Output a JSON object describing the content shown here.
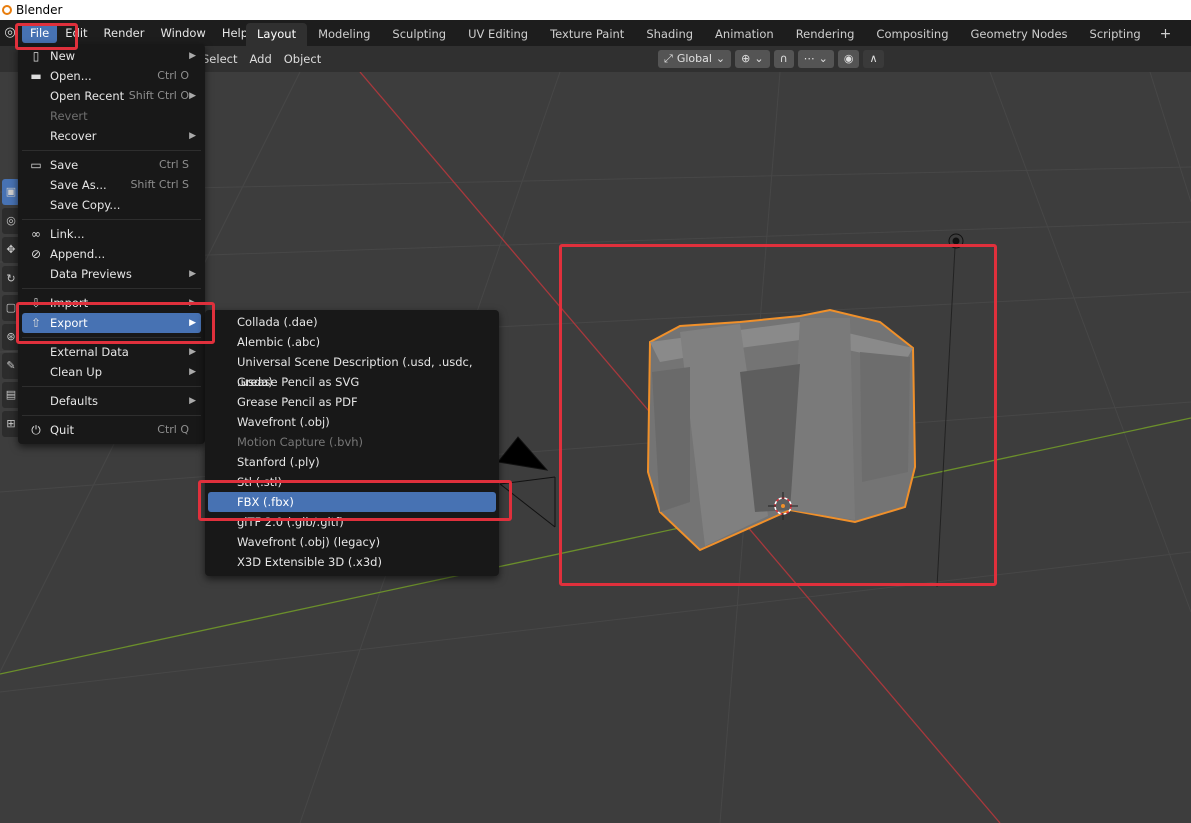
{
  "window": {
    "title": "Blender"
  },
  "topbar": {
    "menus": [
      "File",
      "Edit",
      "Render",
      "Window",
      "Help"
    ],
    "active_menu": "File",
    "workspaces": [
      "Layout",
      "Modeling",
      "Sculpting",
      "UV Editing",
      "Texture Paint",
      "Shading",
      "Animation",
      "Rendering",
      "Compositing",
      "Geometry Nodes",
      "Scripting"
    ],
    "active_workspace": "Layout",
    "add_workspace": "+"
  },
  "viewport_header": {
    "menus": [
      "Select",
      "Add",
      "Object"
    ],
    "orientation": "Global"
  },
  "file_menu": {
    "items": [
      {
        "label": "New",
        "icon": "new-file-icon",
        "shortcut": "",
        "submenu": true
      },
      {
        "label": "Open...",
        "icon": "folder-icon",
        "shortcut": "Ctrl O"
      },
      {
        "label": "Open Recent",
        "shortcut": "Shift Ctrl O",
        "submenu": true
      },
      {
        "label": "Revert",
        "shortcut": "",
        "disabled": true
      },
      {
        "label": "Recover",
        "shortcut": "",
        "submenu": true
      },
      {
        "label": "Save",
        "icon": "save-icon",
        "shortcut": "Ctrl S"
      },
      {
        "label": "Save As...",
        "shortcut": "Shift Ctrl S"
      },
      {
        "label": "Save Copy...",
        "shortcut": ""
      },
      {
        "label": "Link...",
        "icon": "link-icon",
        "shortcut": ""
      },
      {
        "label": "Append...",
        "icon": "append-icon",
        "shortcut": ""
      },
      {
        "label": "Data Previews",
        "shortcut": "",
        "submenu": true
      },
      {
        "label": "Import",
        "icon": "import-icon",
        "shortcut": "",
        "submenu": true
      },
      {
        "label": "Export",
        "icon": "export-icon",
        "shortcut": "",
        "submenu": true,
        "highlighted": true
      },
      {
        "label": "External Data",
        "shortcut": "",
        "submenu": true
      },
      {
        "label": "Clean Up",
        "shortcut": "",
        "submenu": true
      },
      {
        "label": "Defaults",
        "shortcut": "",
        "submenu": true
      },
      {
        "label": "Quit",
        "icon": "quit-icon",
        "shortcut": "Ctrl Q"
      }
    ]
  },
  "export_menu": {
    "items": [
      {
        "label": "Collada (.dae)"
      },
      {
        "label": "Alembic (.abc)"
      },
      {
        "label": "Universal Scene Description (.usd, .usdc, .usda)"
      },
      {
        "label": "Grease Pencil as SVG"
      },
      {
        "label": "Grease Pencil as PDF"
      },
      {
        "label": "Wavefront (.obj)"
      },
      {
        "label": "Motion Capture (.bvh)",
        "disabled": true
      },
      {
        "label": "Stanford (.ply)"
      },
      {
        "label": "Stl (.stl)"
      },
      {
        "label": "FBX (.fbx)",
        "highlighted": true
      },
      {
        "label": "glTF 2.0 (.glb/.gltf)"
      },
      {
        "label": "Wavefront (.obj) (legacy)"
      },
      {
        "label": "X3D Extensible 3D (.x3d)"
      }
    ]
  },
  "colors": {
    "accent": "#4772b3",
    "annotation": "#e0303c",
    "selection_outline": "#f0902a"
  }
}
